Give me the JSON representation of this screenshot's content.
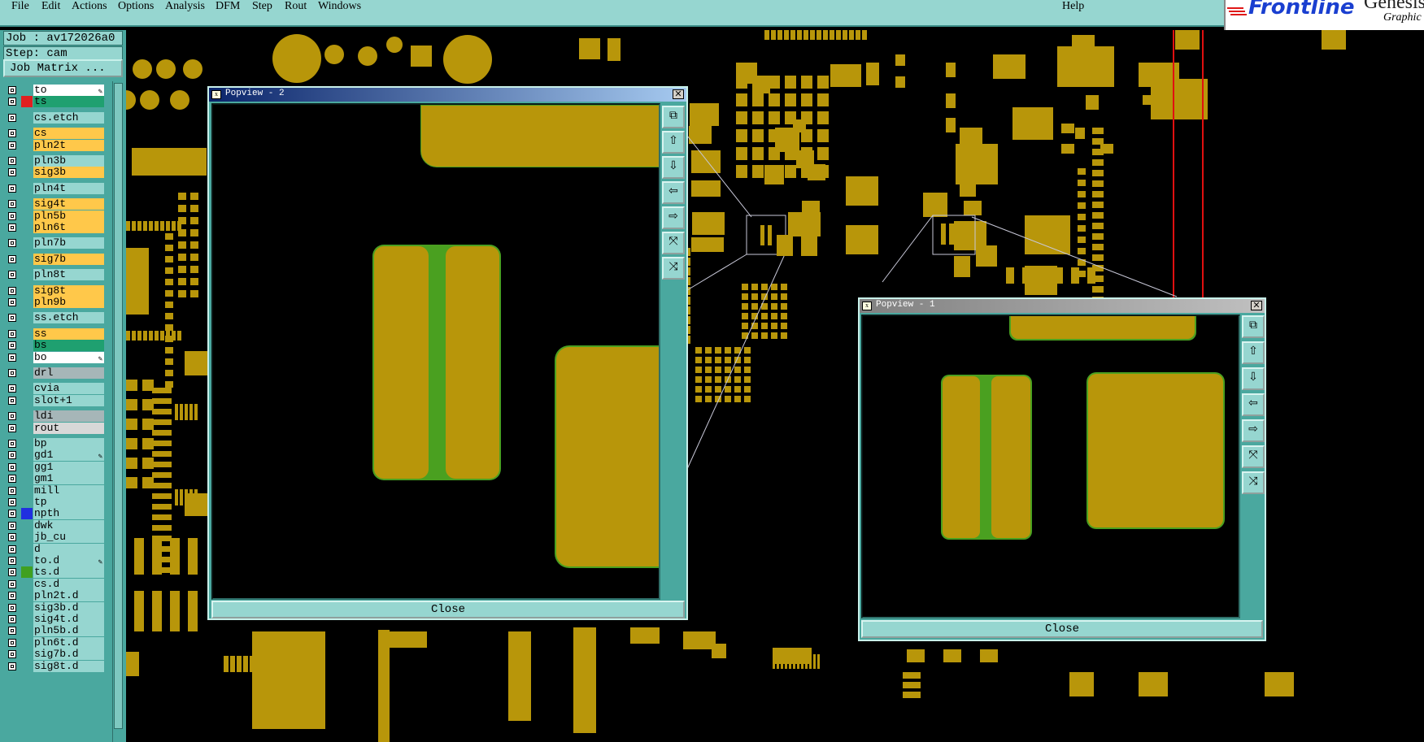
{
  "menu": {
    "items": [
      "File",
      "Edit",
      "Actions",
      "Options",
      "Analysis",
      "DFM",
      "Step",
      "Rout",
      "Windows"
    ],
    "help": "Help"
  },
  "logo": {
    "brand": "Frontline",
    "product": "Genesis",
    "subtitle": "Graphic"
  },
  "info": {
    "job": "Job : av172026a0",
    "step": "Step: cam"
  },
  "job_matrix_label": "Job Matrix ...",
  "layers": [
    {
      "name": "to",
      "style": "white",
      "swatch": "",
      "pen": true
    },
    {
      "name": "ts",
      "style": "green",
      "swatch": "#e02020",
      "pen": false
    },
    {
      "name": "cs.etch",
      "style": "",
      "swatch": "",
      "pen": false
    },
    {
      "name": "cs",
      "style": "yellow",
      "swatch": "",
      "pen": false
    },
    {
      "name": "pln2t",
      "style": "yellow",
      "swatch": "",
      "pen": false
    },
    {
      "name": "pln3b",
      "style": "",
      "swatch": "",
      "pen": false
    },
    {
      "name": "sig3b",
      "style": "yellow",
      "swatch": "",
      "pen": false
    },
    {
      "name": "pln4t",
      "style": "",
      "swatch": "",
      "pen": false
    },
    {
      "name": "sig4t",
      "style": "yellow",
      "swatch": "",
      "pen": false
    },
    {
      "name": "pln5b",
      "style": "yellow",
      "swatch": "",
      "pen": false
    },
    {
      "name": "pln6t",
      "style": "yellow",
      "swatch": "",
      "pen": false
    },
    {
      "name": "pln7b",
      "style": "",
      "swatch": "",
      "pen": false
    },
    {
      "name": "sig7b",
      "style": "yellow",
      "swatch": "",
      "pen": false
    },
    {
      "name": "pln8t",
      "style": "",
      "swatch": "",
      "pen": false
    },
    {
      "name": "sig8t",
      "style": "yellow",
      "swatch": "",
      "pen": false
    },
    {
      "name": "pln9b",
      "style": "yellow",
      "swatch": "",
      "pen": false
    },
    {
      "name": "ss.etch",
      "style": "",
      "swatch": "",
      "pen": false
    },
    {
      "name": "ss",
      "style": "yellow",
      "swatch": "",
      "pen": false
    },
    {
      "name": "bs",
      "style": "green",
      "swatch": "",
      "pen": false
    },
    {
      "name": "bo",
      "style": "white",
      "swatch": "",
      "pen": true
    },
    {
      "name": "drl",
      "style": "grey",
      "swatch": "",
      "pen": false
    },
    {
      "name": "cvia",
      "style": "",
      "swatch": "",
      "pen": false
    },
    {
      "name": "slot+1",
      "style": "",
      "swatch": "",
      "pen": false
    },
    {
      "name": "ldi",
      "style": "grey",
      "swatch": "",
      "pen": false
    },
    {
      "name": "rout",
      "style": "lightgrey",
      "swatch": "",
      "pen": false
    },
    {
      "name": "bp",
      "style": "",
      "swatch": "",
      "pen": false
    },
    {
      "name": "gd1",
      "style": "",
      "swatch": "",
      "pen": true
    },
    {
      "name": "gg1",
      "style": "",
      "swatch": "",
      "pen": false
    },
    {
      "name": "gm1",
      "style": "",
      "swatch": "",
      "pen": false
    },
    {
      "name": "mill",
      "style": "",
      "swatch": "",
      "pen": false
    },
    {
      "name": "tp",
      "style": "",
      "swatch": "",
      "pen": false
    },
    {
      "name": "npth",
      "style": "",
      "swatch": "#2030e0",
      "pen": false
    },
    {
      "name": "dwk",
      "style": "",
      "swatch": "",
      "pen": false
    },
    {
      "name": "jb_cu",
      "style": "",
      "swatch": "",
      "pen": false
    },
    {
      "name": "d",
      "style": "",
      "swatch": "",
      "pen": false
    },
    {
      "name": "to.d",
      "style": "",
      "swatch": "",
      "pen": true
    },
    {
      "name": "ts.d",
      "style": "",
      "swatch": "#40a020",
      "pen": false
    },
    {
      "name": "cs.d",
      "style": "",
      "swatch": "",
      "pen": false
    },
    {
      "name": "pln2t.d",
      "style": "",
      "swatch": "",
      "pen": false
    },
    {
      "name": "sig3b.d",
      "style": "",
      "swatch": "",
      "pen": false
    },
    {
      "name": "sig4t.d",
      "style": "",
      "swatch": "",
      "pen": false
    },
    {
      "name": "pln5b.d",
      "style": "",
      "swatch": "",
      "pen": false
    },
    {
      "name": "pln6t.d",
      "style": "",
      "swatch": "",
      "pen": false
    },
    {
      "name": "sig7b.d",
      "style": "",
      "swatch": "",
      "pen": false
    },
    {
      "name": "sig8t.d",
      "style": "",
      "swatch": "",
      "pen": false
    }
  ],
  "popview2": {
    "title": "Popview - 2",
    "close_label": "Close"
  },
  "popview1": {
    "title": "Popview - 1",
    "close_label": "Close"
  },
  "colors": {
    "copper": "#b8960a",
    "soldermask_green": "#4aa020",
    "panel": "#96d6d0",
    "panel_dark": "#4aa89f",
    "profile_red": "#e01010"
  },
  "tool_icons": [
    "zoom-fit-icon",
    "pan-up-icon",
    "pan-down-icon",
    "pan-left-icon",
    "pan-right-icon",
    "zoom-out-icon",
    "zoom-in-icon"
  ]
}
